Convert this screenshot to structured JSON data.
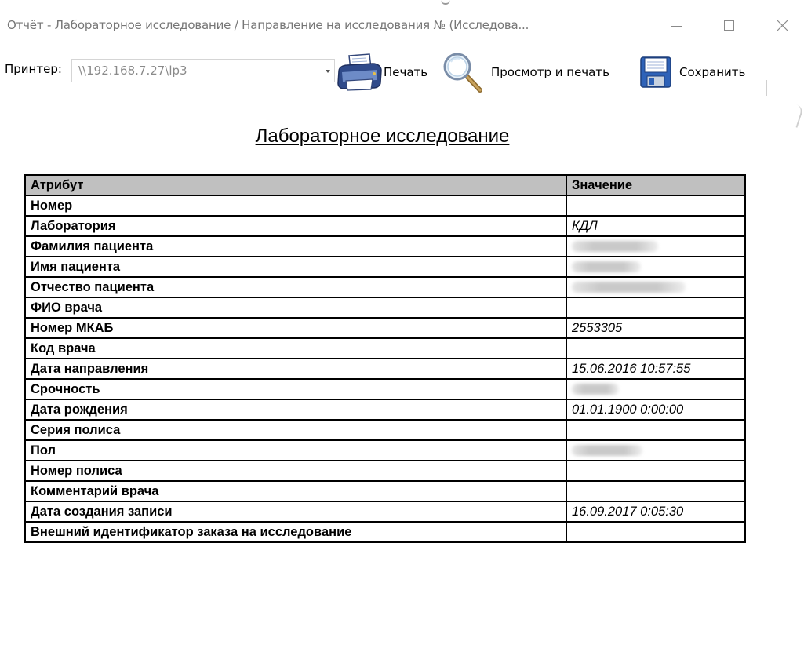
{
  "window": {
    "title": "Отчёт - Лабораторное исследование / Направление на исследования № (Исследова..."
  },
  "toolbar": {
    "printer_label": "Принтер:",
    "printer_value": "\\\\192.168.7.27\\lp3",
    "print_label": "Печать",
    "preview_label": "Просмотр и печать",
    "save_label": "Сохранить"
  },
  "report": {
    "title": "Лабораторное исследование",
    "table": {
      "headers": [
        "Атрибут",
        "Значение"
      ],
      "rows": [
        {
          "attr": "Номер",
          "value": ""
        },
        {
          "attr": "Лаборатория",
          "value": "КДЛ"
        },
        {
          "attr": "Фамилия пациента",
          "value": ""
        },
        {
          "attr": "Имя пациента",
          "value": ""
        },
        {
          "attr": "Отчество пациента",
          "value": ""
        },
        {
          "attr": "ФИО врача",
          "value": ""
        },
        {
          "attr": "Номер МКАБ",
          "value": "2553305"
        },
        {
          "attr": "Код врача",
          "value": ""
        },
        {
          "attr": "Дата направления",
          "value": "15.06.2016 10:57:55"
        },
        {
          "attr": "Срочность",
          "value": ""
        },
        {
          "attr": "Дата рождения",
          "value": "01.01.1900 0:00:00"
        },
        {
          "attr": "Серия полиса",
          "value": ""
        },
        {
          "attr": "Пол",
          "value": ""
        },
        {
          "attr": "Номер полиса",
          "value": ""
        },
        {
          "attr": "Комментарий врача",
          "value": ""
        },
        {
          "attr": "Дата создания записи",
          "value": "16.09.2017 0:05:30"
        },
        {
          "attr": "Внешний идентификатор заказа на исследование",
          "value": ""
        }
      ]
    }
  },
  "icons": {
    "print": "printer-icon",
    "preview": "magnifier-icon",
    "save": "floppy-disk-icon",
    "dropdown": "chevron-down-icon",
    "minimize": "minimize-icon",
    "maximize": "maximize-icon",
    "close": "close-icon"
  }
}
